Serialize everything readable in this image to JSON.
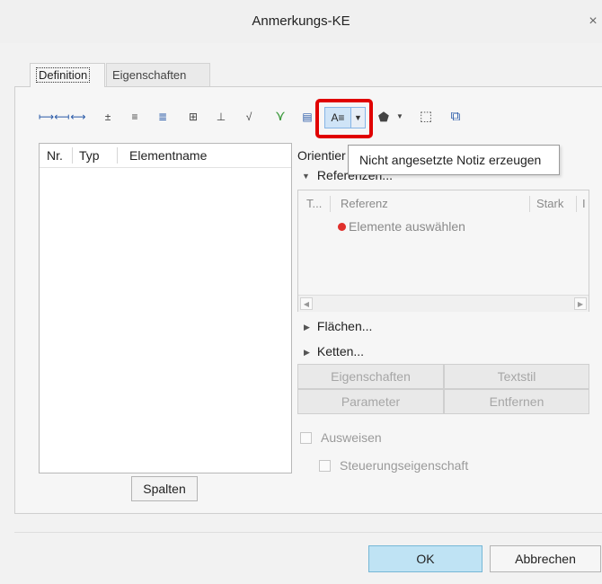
{
  "window": {
    "title": "Anmerkungs-KE",
    "close_glyph": "×"
  },
  "tabs": [
    {
      "label": "Definition",
      "active": true
    },
    {
      "label": "Eigenschaften",
      "active": false
    }
  ],
  "toolbar": {
    "icons": [
      {
        "name": "dimension-icon",
        "glyph": "⟼⟻"
      },
      {
        "name": "reference-dimension-icon",
        "glyph": "⟷"
      },
      {
        "name": "tolerance-icon-1",
        "glyph": "±"
      },
      {
        "name": "tolerance-icon-2",
        "glyph": "≡"
      },
      {
        "name": "tolerance-icon-3",
        "glyph": "≣"
      },
      {
        "name": "gtol-icon",
        "glyph": "⊞"
      },
      {
        "name": "datum-icon",
        "glyph": "⊥"
      },
      {
        "name": "surface-finish-icon",
        "glyph": "√"
      },
      {
        "name": "datum-target-icon",
        "glyph": "⋎"
      },
      {
        "name": "table-icon",
        "glyph": "▤"
      }
    ],
    "highlighted_icon": {
      "name": "note-icon",
      "glyph": "A≡"
    },
    "icons_after": [
      {
        "name": "symbol-icon",
        "glyph": "⬟"
      },
      {
        "name": "frame-icon",
        "glyph": "⬚"
      },
      {
        "name": "copy-icon",
        "glyph": "⧉"
      }
    ]
  },
  "tooltip": {
    "text": "Nicht angesetzte Notiz erzeugen"
  },
  "element_list": {
    "columns": [
      "Nr.",
      "Typ",
      "Elementname"
    ],
    "rows": []
  },
  "buttons": {
    "spalten": "Spalten",
    "eigenschaften": "Eigenschaften",
    "textstil": "Textstil",
    "parameter": "Parameter",
    "entfernen": "Entfernen",
    "ok": "OK",
    "abbrechen": "Abbrechen"
  },
  "right_panel": {
    "orientation_label": "Orientier",
    "references": {
      "header": "Referenzen...",
      "columns": [
        "T...",
        "Referenz",
        "Stark",
        "I"
      ],
      "placeholder": "Elemente auswählen"
    },
    "flaechen": "Flächen...",
    "ketten": "Ketten...",
    "ausweisen": "Ausweisen",
    "steuerungseigenschaft": "Steuerungseigenschaft"
  },
  "colors": {
    "highlight_border": "#e00000",
    "ok_button": "#bfe3f4",
    "selection_dot": "#e0302c"
  }
}
